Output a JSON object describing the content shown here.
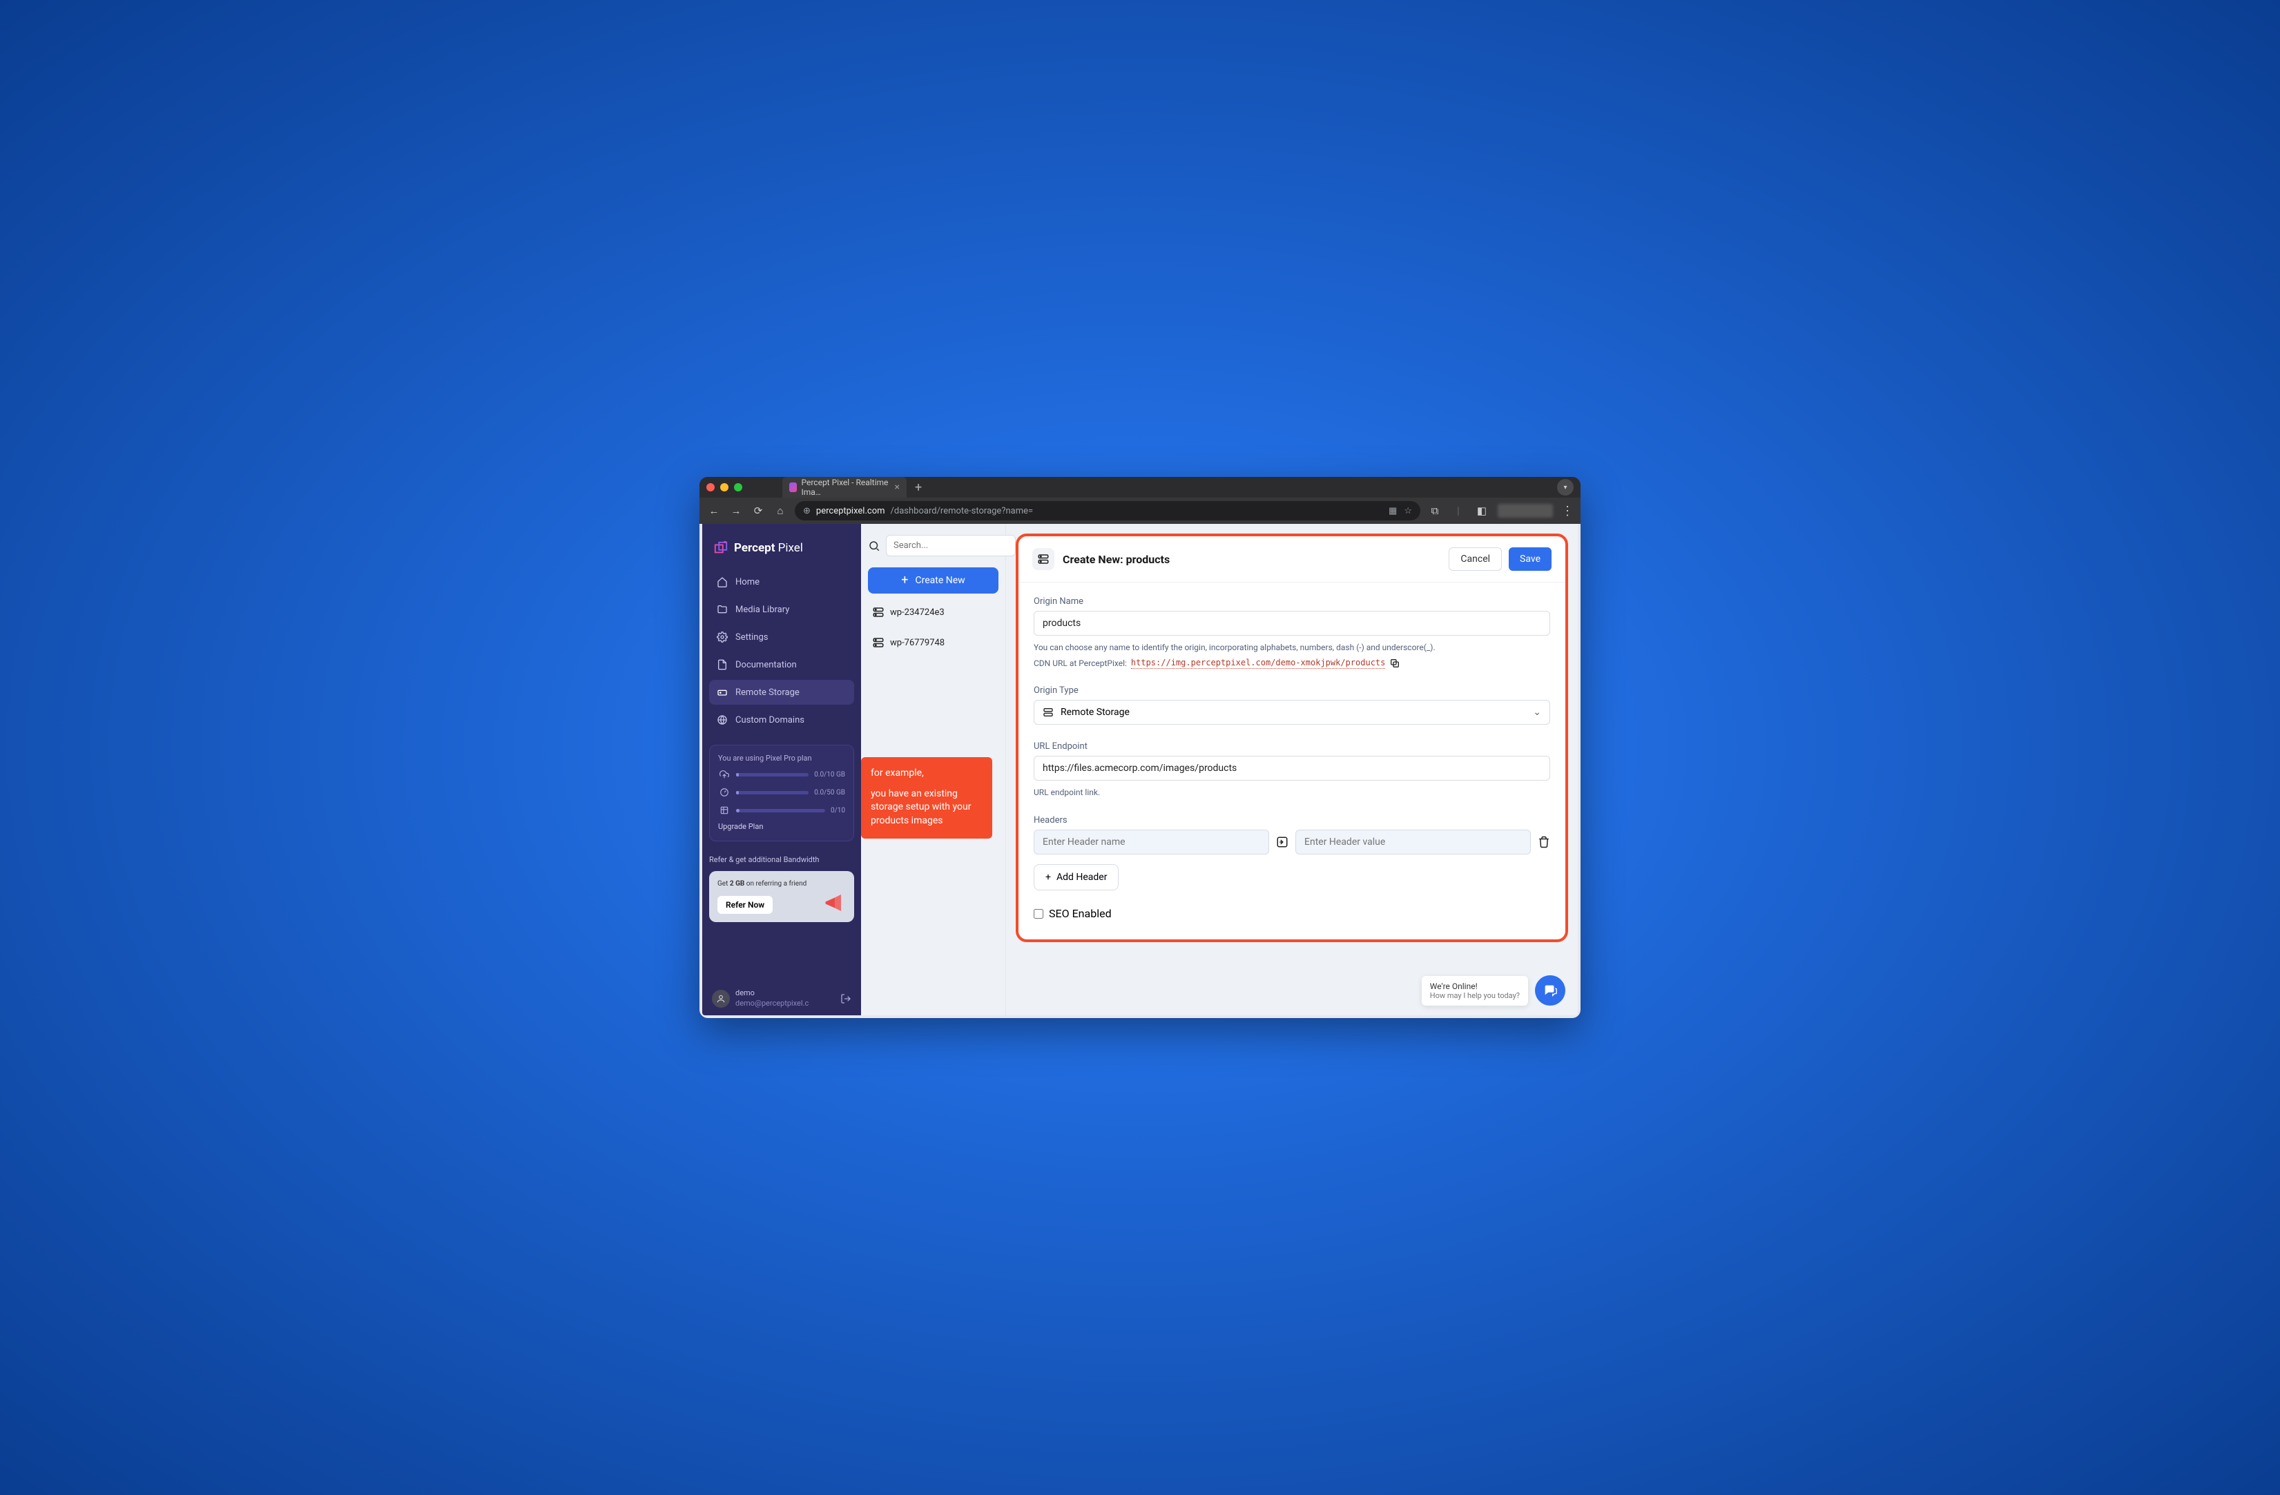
{
  "browser": {
    "tab_title": "Percept Pixel - Realtime Ima…",
    "url_host": "perceptpixel.com",
    "url_path": "/dashboard/remote-storage?name="
  },
  "sidebar": {
    "brand_bold": "Percept",
    "brand_light": " Pixel",
    "items": [
      {
        "label": "Home",
        "icon": "home"
      },
      {
        "label": "Media Library",
        "icon": "folder"
      },
      {
        "label": "Settings",
        "icon": "gear"
      },
      {
        "label": "Documentation",
        "icon": "doc"
      },
      {
        "label": "Remote Storage",
        "icon": "drive"
      },
      {
        "label": "Custom Domains",
        "icon": "globe"
      }
    ],
    "plan_line": "You are using Pixel Pro plan",
    "metrics": [
      {
        "value": "0.0/10 GB"
      },
      {
        "value": "0.0/50 GB"
      },
      {
        "value": "0/10"
      }
    ],
    "upgrade_label": "Upgrade Plan",
    "refer_title": "Refer & get additional Bandwidth",
    "refer_text_pre": "Get ",
    "refer_text_bold": "2 GB",
    "refer_text_post": " on referring a friend",
    "refer_btn": "Refer Now",
    "user_name": "demo",
    "user_email": "demo@perceptpixel.c"
  },
  "midpanel": {
    "search_placeholder": "Search...",
    "create_label": "Create New",
    "items": [
      {
        "label": "wp-234724e3"
      },
      {
        "label": "wp-76779748"
      }
    ],
    "callout_l1": "for example,",
    "callout_l2": "you have an existing storage setup with your products images"
  },
  "form": {
    "title": "Create New: products",
    "cancel": "Cancel",
    "save": "Save",
    "origin_name_label": "Origin Name",
    "origin_name_value": "products",
    "origin_name_hint": "You can choose any name to identify the origin, incorporating alphabets, numbers, dash (-) and underscore(_).",
    "cdn_label": "CDN URL at PerceptPixel: ",
    "cdn_url": "https://img.perceptpixel.com/demo-xmokjpwk/products",
    "origin_type_label": "Origin Type",
    "origin_type_value": "Remote Storage",
    "url_endpoint_label": "URL Endpoint",
    "url_endpoint_value": "https://files.acmecorp.com/images/products",
    "url_endpoint_hint": "URL endpoint link.",
    "headers_label": "Headers",
    "header_name_ph": "Enter Header name",
    "header_value_ph": "Enter Header value",
    "add_header": "Add Header",
    "seo_label": "SEO Enabled"
  },
  "chat": {
    "line1": "We're Online!",
    "line2": "How may I help you today?"
  }
}
